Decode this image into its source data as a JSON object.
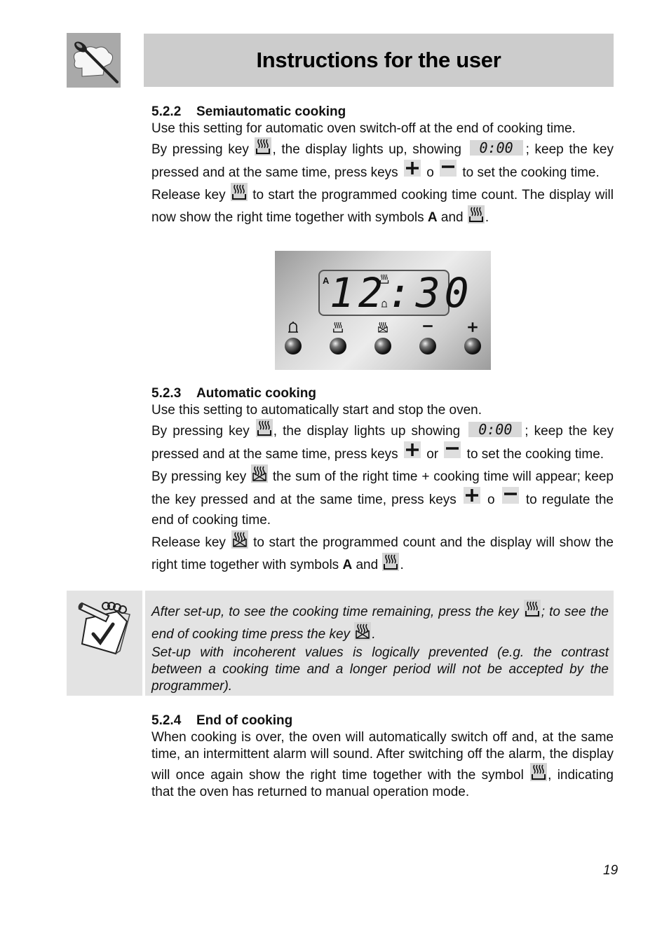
{
  "header": {
    "title": "Instructions for the user",
    "logo_icon": "chef-hat-spoon-icon"
  },
  "sections": [
    {
      "number": "5.2.2",
      "title": "Semiautomatic cooking",
      "intro": "Use this setting for automatic oven switch-off at the end of cooking time.",
      "p1": {
        "a": "By pressing key ",
        "b": ", the display lights up, showing ",
        "display": "0:00",
        "c": "; keep the key pressed and at the same time, press keys ",
        "d": " o ",
        "e": " to set the cooking time."
      },
      "p2": {
        "a": "Release key ",
        "b": " to start the programmed cooking time count. The display will now show the right time together with symbols ",
        "bold": "A",
        "c": " and ",
        "d": "."
      }
    },
    {
      "number": "5.2.3",
      "title": "Automatic cooking",
      "intro": "Use this setting to automatically start and stop the oven.",
      "p1": {
        "a": "By pressing key ",
        "b": ", the display lights up showing ",
        "display": "0:00",
        "c": "; keep the key pressed and at the same time, press keys ",
        "d": " or ",
        "e": " to set the cooking time."
      },
      "p2": {
        "a": "By pressing key ",
        "b": " the sum of the right time + cooking time will appear; keep the key pressed and at the same time, press keys ",
        "c": " o ",
        "d": " to regulate the end of cooking time."
      },
      "p3": {
        "a": "Release key ",
        "b": " to start the programmed count and the display will show the right time together with symbols ",
        "bold": "A",
        "c": " and ",
        "d": "."
      }
    },
    {
      "number": "5.2.4",
      "title": "End of cooking",
      "p1": {
        "a": "When cooking is over, the oven will automatically switch off and, at the same time, an intermittent alarm will sound. After switching off the alarm, the display will once again show the right time together with the symbol ",
        "b": ", indicating that the oven has returned to manual operation mode."
      }
    }
  ],
  "control_panel": {
    "display_time": "12:30",
    "display_symbol_a": "A",
    "buttons": [
      {
        "name": "alarm-bell",
        "icon": "bell-icon"
      },
      {
        "name": "cooking-time",
        "icon": "oven-steam-icon"
      },
      {
        "name": "end-of-cooking",
        "icon": "oven-end-icon"
      },
      {
        "name": "minus",
        "icon": "minus-icon"
      },
      {
        "name": "plus",
        "icon": "plus-icon"
      }
    ]
  },
  "note": {
    "icon": "notepad-check-icon",
    "p1": {
      "a": "After set-up, to see the cooking time remaining, press the key ",
      "b": "; to see the end of cooking time press the key ",
      "c": "."
    },
    "p2": "Set-up with incoherent values is logically prevented (e.g. the contrast between a cooking time and a longer period will not be accepted by the programmer)."
  },
  "footer": {
    "page_number": "19"
  }
}
